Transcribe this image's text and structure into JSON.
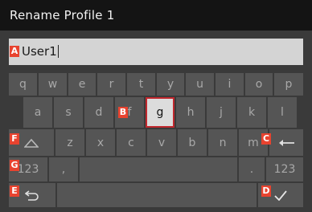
{
  "title": "Rename Profile 1",
  "input": {
    "value": "User1"
  },
  "keyboard": {
    "row1": [
      "q",
      "w",
      "e",
      "r",
      "t",
      "y",
      "u",
      "i",
      "o",
      "p"
    ],
    "row2": [
      "a",
      "s",
      "d",
      "f",
      "g",
      "h",
      "j",
      "k",
      "l"
    ],
    "row3": [
      "z",
      "x",
      "c",
      "v",
      "b",
      "n",
      "m"
    ],
    "row4": {
      "left": "123",
      "comma": ",",
      "period": ".",
      "right": "123"
    },
    "selected_key": "g"
  },
  "markers": {
    "A": "A",
    "B": "B",
    "C": "C",
    "D": "D",
    "E": "E",
    "F": "F",
    "G": "G"
  },
  "icons": {
    "shift": "shift-icon",
    "backspace": "backspace-arrow-icon",
    "back": "back-return-icon",
    "confirm": "checkmark-icon"
  },
  "colors": {
    "selected_border": "#c0272d",
    "marker": "#e8432f"
  }
}
